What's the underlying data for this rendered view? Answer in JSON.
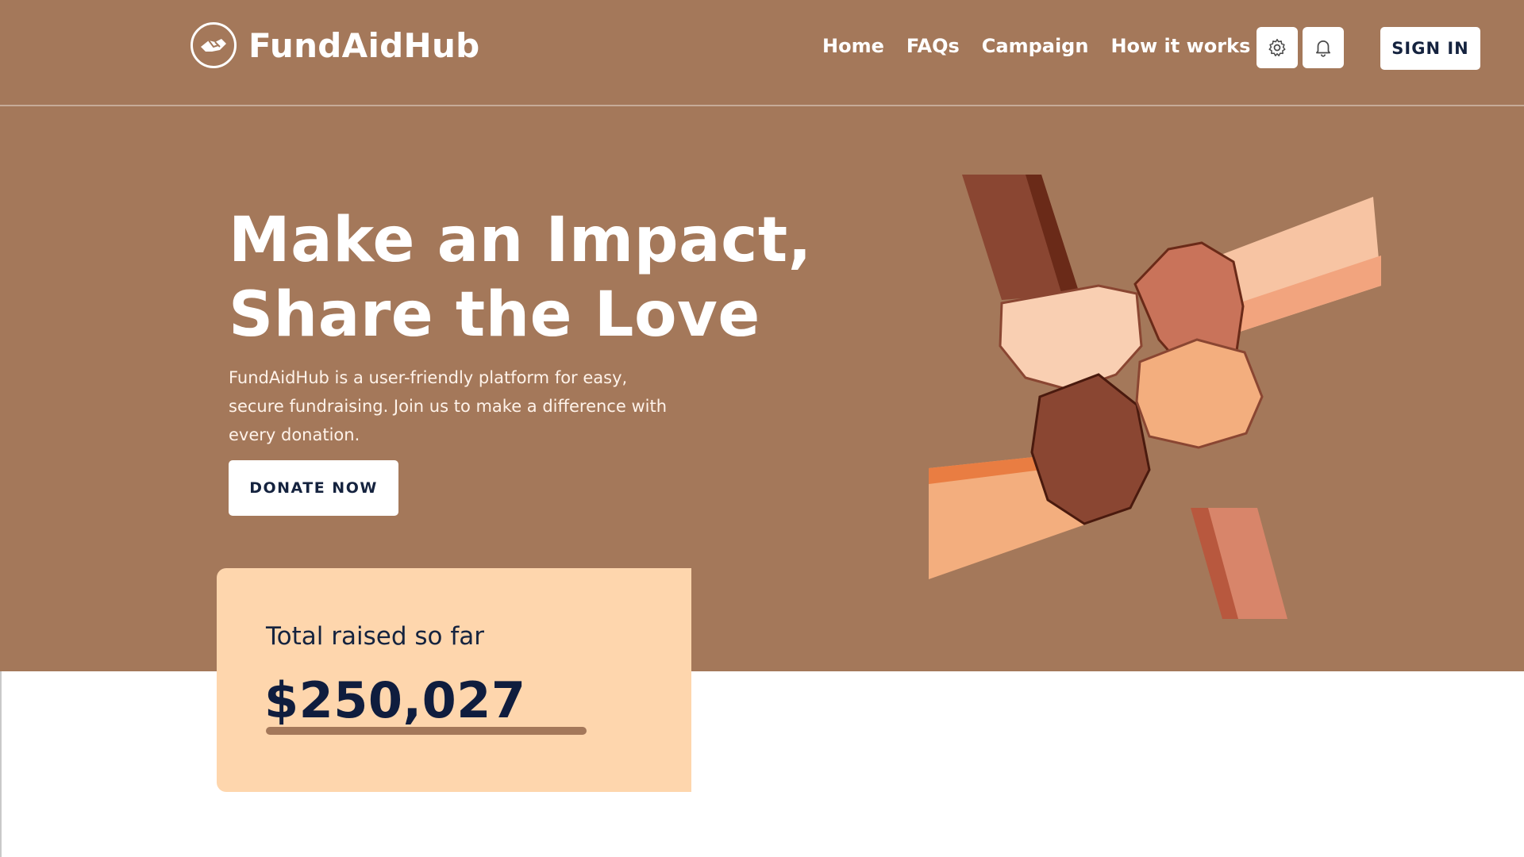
{
  "brand": {
    "name": "FundAidHub",
    "logo_icon": "helping-hands-icon"
  },
  "nav": {
    "links": [
      {
        "label": "Home"
      },
      {
        "label": "FAQs"
      },
      {
        "label": "Campaign"
      },
      {
        "label": "How it works"
      }
    ],
    "settings_icon": "gear-icon",
    "notifications_icon": "bell-icon",
    "signin_label": "SIGN IN"
  },
  "hero": {
    "title_line1": "Make an Impact,",
    "title_line2": "Share the Love",
    "description": "FundAidHub is a user-friendly platform for easy, secure fundraising. Join us to make a difference with every donation.",
    "donate_label": "DONATE NOW",
    "illustration": "stacked-hands-illustration"
  },
  "stats": {
    "label": "Total raised so far",
    "amount": "$250,027"
  },
  "colors": {
    "hero_bg": "#a4785a",
    "card_bg": "#fed6ad",
    "text_dark": "#15233f",
    "white": "#ffffff"
  }
}
